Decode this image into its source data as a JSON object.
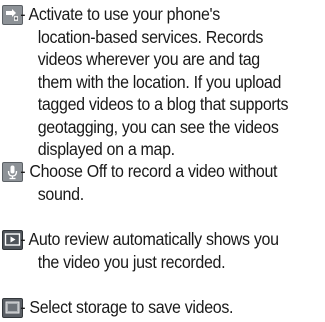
{
  "entries": [
    {
      "icon": "geotag-icon",
      "lines": [
        " - Activate to use your phone's",
        "location-based services. Records",
        "videos wherever you are and tag",
        "them with the location. If you upload",
        "tagged videos to a blog that supports",
        "geotagging, you can see the videos",
        "displayed on a map."
      ]
    },
    {
      "icon": "microphone-icon",
      "lines": [
        " - Choose Off to record a video without",
        "sound."
      ]
    },
    {
      "icon": "auto-review-icon",
      "lines": [
        " - Auto review automatically shows you",
        "the video you just recorded."
      ]
    },
    {
      "icon": "storage-icon",
      "lines": [
        " - Select storage to save videos."
      ]
    }
  ]
}
